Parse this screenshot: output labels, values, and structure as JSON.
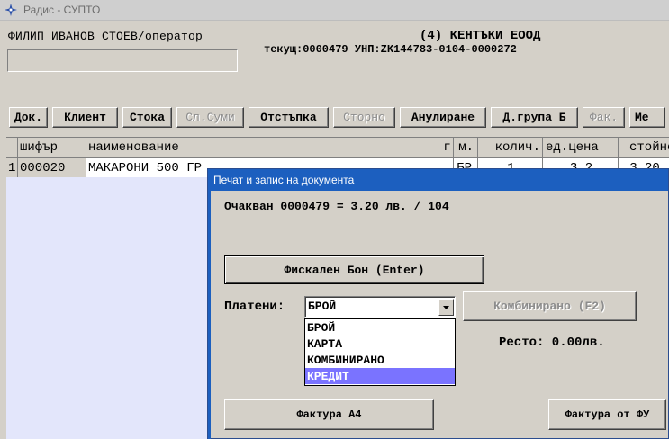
{
  "window": {
    "title": "Радис - СУПТО",
    "icon": "compass-icon"
  },
  "header": {
    "operator": "ФИЛИП ИВАНОВ СТОЕВ/оператор",
    "company": "(4) КЕНТЪКИ ЕООД",
    "current": "текущ:0000479 УНП:ZK144783-0104-0000272"
  },
  "toolbar": {
    "buttons": [
      {
        "label": "Док.",
        "enabled": true
      },
      {
        "label": "Клиент",
        "enabled": true
      },
      {
        "label": "Стока",
        "enabled": true
      },
      {
        "label": "Сл.Суми",
        "enabled": false
      },
      {
        "label": "Отстъпка",
        "enabled": true
      },
      {
        "label": "Сторно",
        "enabled": false
      },
      {
        "label": "Анулиране",
        "enabled": true
      },
      {
        "label": "Д.група Б",
        "enabled": true
      },
      {
        "label": "Фак.",
        "enabled": false
      },
      {
        "label": "Ме",
        "enabled": true
      }
    ]
  },
  "grid": {
    "columns": [
      "шифър",
      "наименование",
      "г м.",
      "колич.",
      "ед.цена",
      "стойност"
    ],
    "rows": [
      {
        "num": "1",
        "code": "000020",
        "name": "МАКАРОНИ 500 ГР",
        "unit": "БР",
        "qty": "1",
        "price": "3.2",
        "total": "3.20"
      }
    ]
  },
  "dialog": {
    "title": "Печат и запис на документа",
    "expected": "Очакван 0000479  = 3.20 лв. / 104",
    "fiscal_button": "Фискален Бон (Enter)",
    "paid_label": "Платени:",
    "payment_selected": "БРОЙ",
    "payment_options": [
      "БРОЙ",
      "КАРТА",
      "КОМБИНИРАНО",
      "КРЕДИТ"
    ],
    "highlighted_option": "КРЕДИТ",
    "combined_button": "Комбинирано (F2)",
    "change": "Ресто: 0.00лв.",
    "invoice_a4_button": "Фактура А4",
    "invoice_fu_button": "Фактура от ФУ"
  }
}
